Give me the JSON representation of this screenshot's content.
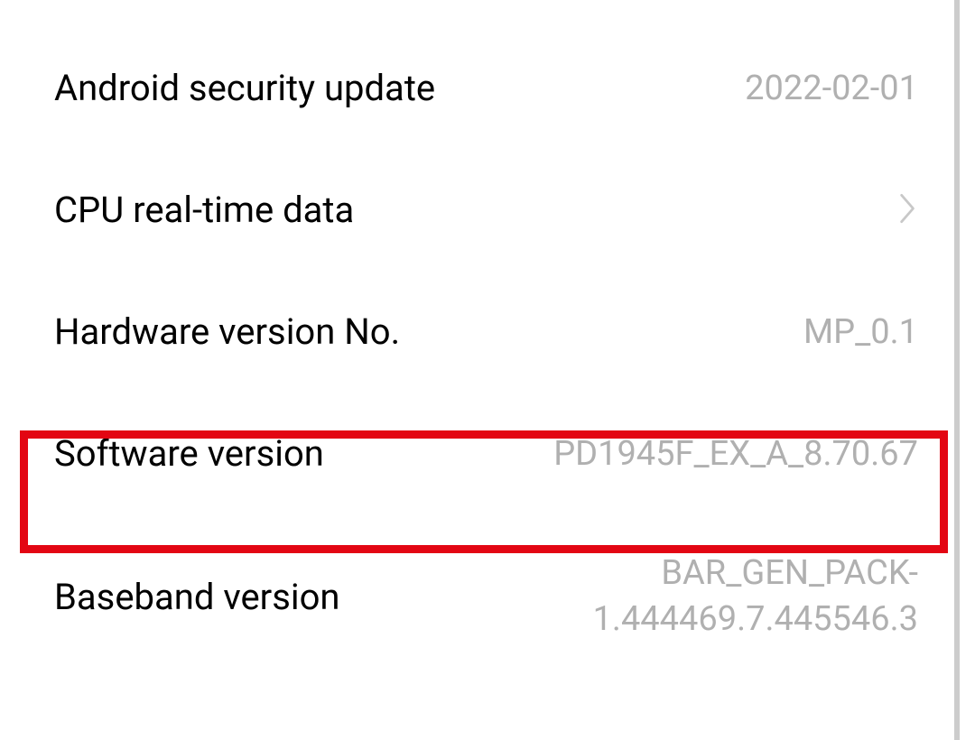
{
  "rows": {
    "security_update": {
      "label": "Android security update",
      "value": "2022-02-01"
    },
    "cpu_data": {
      "label": "CPU real-time data"
    },
    "hardware_version": {
      "label": "Hardware version No.",
      "value": "MP_0.1"
    },
    "software_version": {
      "label": "Software version",
      "value": "PD1945F_EX_A_8.70.67"
    },
    "baseband_version": {
      "label": "Baseband version",
      "value": "BAR_GEN_PACK-1.444469.7.445546.3"
    }
  }
}
